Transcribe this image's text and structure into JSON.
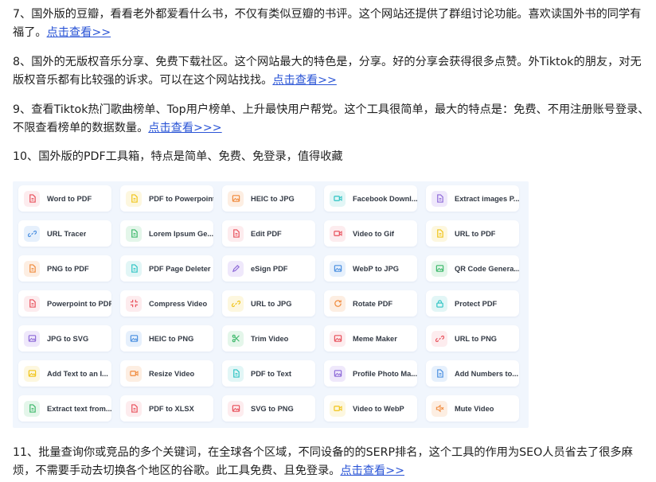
{
  "paragraphs": {
    "p7": {
      "text": "7、国外版的豆瓣，看看老外都爱看什么书，不仅有类似豆瓣的书评。这个网站还提供了群组讨论功能。喜欢读国外书的同学有福了。",
      "link": "点击查看>>"
    },
    "p8": {
      "text": "8、国外的无版权音乐分享、免费下载社区。这个网站最大的特色是，分享。好的分享会获得很多点赞。外Tiktok的朋友，对无版权音乐都有比较强的诉求。可以在这个网站找找。",
      "link": "点击查看>>"
    },
    "p9": {
      "text": "9、查看Tiktok热门歌曲榜单、Top用户榜单、上升最快用户帮党。这个工具很简单，最大的特点是：免费、不用注册账号登录、不限查看榜单的数据数量。",
      "link": "点击查看>>>"
    },
    "p10": {
      "text": "10、国外版的PDF工具箱，特点是简单、免费、免登录，值得收藏"
    },
    "p11": {
      "text": "11、批量查询你或竞品的多个关键词，在全球各个区域，不同设备的的SERP排名，这个工具的作用为SEO人员省去了很多麻烦，不需要手动去切换各个地区的谷歌。此工具免费、且免登录。",
      "link": "点击查看>>"
    }
  },
  "tools": [
    {
      "label": "Word to PDF",
      "icon": "document-icon",
      "color": "#e8505b",
      "bg": "#fdecee"
    },
    {
      "label": "PDF to Powerpoint",
      "icon": "document-icon",
      "color": "#f0c419",
      "bg": "#fdf7df"
    },
    {
      "label": "HEIC to JPG",
      "icon": "image-icon",
      "color": "#f08a3c",
      "bg": "#fdeee2"
    },
    {
      "label": "Facebook Downl...",
      "icon": "video-icon",
      "color": "#2ec4c4",
      "bg": "#e2f6f6"
    },
    {
      "label": "Extract images P...",
      "icon": "document-icon",
      "color": "#8e6ad8",
      "bg": "#efe8fb"
    },
    {
      "label": "URL Tracer",
      "icon": "link-icon",
      "color": "#4a8fe0",
      "bg": "#e6f0fc"
    },
    {
      "label": "Lorem Ipsum Ge...",
      "icon": "document-icon",
      "color": "#3cb86a",
      "bg": "#e4f6ea"
    },
    {
      "label": "Edit PDF",
      "icon": "document-icon",
      "color": "#e8505b",
      "bg": "#fdecee"
    },
    {
      "label": "Video to Gif",
      "icon": "video-icon",
      "color": "#e8505b",
      "bg": "#fdecee"
    },
    {
      "label": "URL to PDF",
      "icon": "document-icon",
      "color": "#f0c419",
      "bg": "#fdf7df"
    },
    {
      "label": "PNG to PDF",
      "icon": "document-icon",
      "color": "#f08a3c",
      "bg": "#fdeee2"
    },
    {
      "label": "PDF Page Deleter",
      "icon": "document-icon",
      "color": "#2ec4c4",
      "bg": "#e2f6f6"
    },
    {
      "label": "eSign PDF",
      "icon": "pen-icon",
      "color": "#8e6ad8",
      "bg": "#efe8fb"
    },
    {
      "label": "WebP to JPG",
      "icon": "image-icon",
      "color": "#4a8fe0",
      "bg": "#e6f0fc"
    },
    {
      "label": "QR Code Genera...",
      "icon": "image-icon",
      "color": "#3cb86a",
      "bg": "#e4f6ea"
    },
    {
      "label": "Powerpoint to PDF",
      "icon": "document-icon",
      "color": "#e8505b",
      "bg": "#fdecee"
    },
    {
      "label": "Compress Video",
      "icon": "compress-icon",
      "color": "#e8505b",
      "bg": "#fdecee"
    },
    {
      "label": "URL to JPG",
      "icon": "link-icon",
      "color": "#f0c419",
      "bg": "#fdf7df"
    },
    {
      "label": "Rotate PDF",
      "icon": "rotate-icon",
      "color": "#f08a3c",
      "bg": "#fdeee2"
    },
    {
      "label": "Protect PDF",
      "icon": "lock-icon",
      "color": "#2ec4c4",
      "bg": "#e2f6f6"
    },
    {
      "label": "JPG to SVG",
      "icon": "image-icon",
      "color": "#8e6ad8",
      "bg": "#efe8fb"
    },
    {
      "label": "HEIC to PNG",
      "icon": "image-icon",
      "color": "#4a8fe0",
      "bg": "#e6f0fc"
    },
    {
      "label": "Trim Video",
      "icon": "scissors-icon",
      "color": "#3cb86a",
      "bg": "#e4f6ea"
    },
    {
      "label": "Meme Maker",
      "icon": "image-icon",
      "color": "#e8505b",
      "bg": "#fdecee"
    },
    {
      "label": "URL to PNG",
      "icon": "link-icon",
      "color": "#e8505b",
      "bg": "#fdecee"
    },
    {
      "label": "Add Text to an I...",
      "icon": "image-icon",
      "color": "#f0c419",
      "bg": "#fdf7df"
    },
    {
      "label": "Resize Video",
      "icon": "video-icon",
      "color": "#f08a3c",
      "bg": "#fdeee2"
    },
    {
      "label": "PDF to Text",
      "icon": "document-icon",
      "color": "#2ec4c4",
      "bg": "#e2f6f6"
    },
    {
      "label": "Profile Photo Ma...",
      "icon": "image-icon",
      "color": "#8e6ad8",
      "bg": "#efe8fb"
    },
    {
      "label": "Add Numbers to...",
      "icon": "document-icon",
      "color": "#4a8fe0",
      "bg": "#e6f0fc"
    },
    {
      "label": "Extract text from...",
      "icon": "document-icon",
      "color": "#3cb86a",
      "bg": "#e4f6ea"
    },
    {
      "label": "PDF to XLSX",
      "icon": "document-icon",
      "color": "#e8505b",
      "bg": "#fdecee"
    },
    {
      "label": "SVG to PNG",
      "icon": "image-icon",
      "color": "#e8505b",
      "bg": "#fdecee"
    },
    {
      "label": "Video to WebP",
      "icon": "video-icon",
      "color": "#f0c419",
      "bg": "#fdf7df"
    },
    {
      "label": "Mute Video",
      "icon": "mute-icon",
      "color": "#f08a3c",
      "bg": "#fdeee2"
    }
  ]
}
